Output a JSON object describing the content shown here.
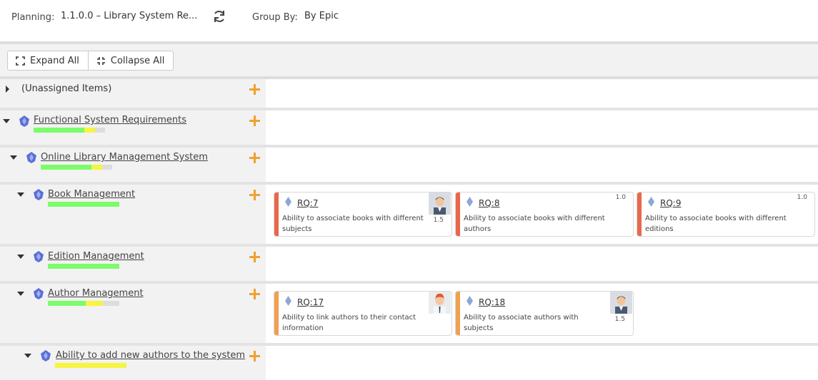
{
  "header": {
    "planning_label": "Planning:",
    "planning_value": "1.1.0.0 – Library System Re...",
    "group_by_label": "Group By:",
    "group_by_value": "By Epic"
  },
  "toolbar": {
    "expand_all": "Expand All",
    "collapse_all": "Collapse All"
  },
  "rows": {
    "unassigned": {
      "label": "(Unassigned Items)"
    },
    "functional": {
      "label": "Functional System Requirements",
      "progress": {
        "done": 0.71,
        "in_progress": 0.15
      }
    },
    "online": {
      "label": "Online Library Management System",
      "progress": {
        "done": 0.71,
        "in_progress": 0.15
      }
    },
    "book": {
      "label": "Book Management",
      "progress": {
        "done": 1.0,
        "in_progress": 0.0
      }
    },
    "edition": {
      "label": "Edition Management",
      "progress": {
        "done": 1.0,
        "in_progress": 0.0
      }
    },
    "author": {
      "label": "Author Management",
      "progress": {
        "done": 0.53,
        "in_progress": 0.24
      }
    },
    "add_authors": {
      "label": "Ability to add new authors to the system",
      "progress": {
        "done": 0.0,
        "in_progress": 1.0
      }
    }
  },
  "cards": {
    "rq7": {
      "id": "RQ:7",
      "description": "Ability to associate books with different subjects",
      "estimate": "1.5",
      "color": "#e8684a"
    },
    "rq8": {
      "id": "RQ:8",
      "description": "Ability to associate books with different authors",
      "estimate": "1.0",
      "color": "#e8684a"
    },
    "rq9": {
      "id": "RQ:9",
      "description": "Ability to associate books with different editions",
      "estimate": "1.0",
      "color": "#e8684a"
    },
    "rq17": {
      "id": "RQ:17",
      "description": "Ability to link authors to their contact information",
      "estimate": "",
      "color": "#f0a050"
    },
    "rq18": {
      "id": "RQ:18",
      "description": "Ability to associate authors with subjects",
      "estimate": "1.5",
      "color": "#f0a050"
    }
  },
  "colors": {
    "progress_done": "#7cfc6a",
    "progress_in_progress": "#f5f542",
    "accent_add": "#f0a030",
    "epic_icon": "#5b6fd6"
  }
}
